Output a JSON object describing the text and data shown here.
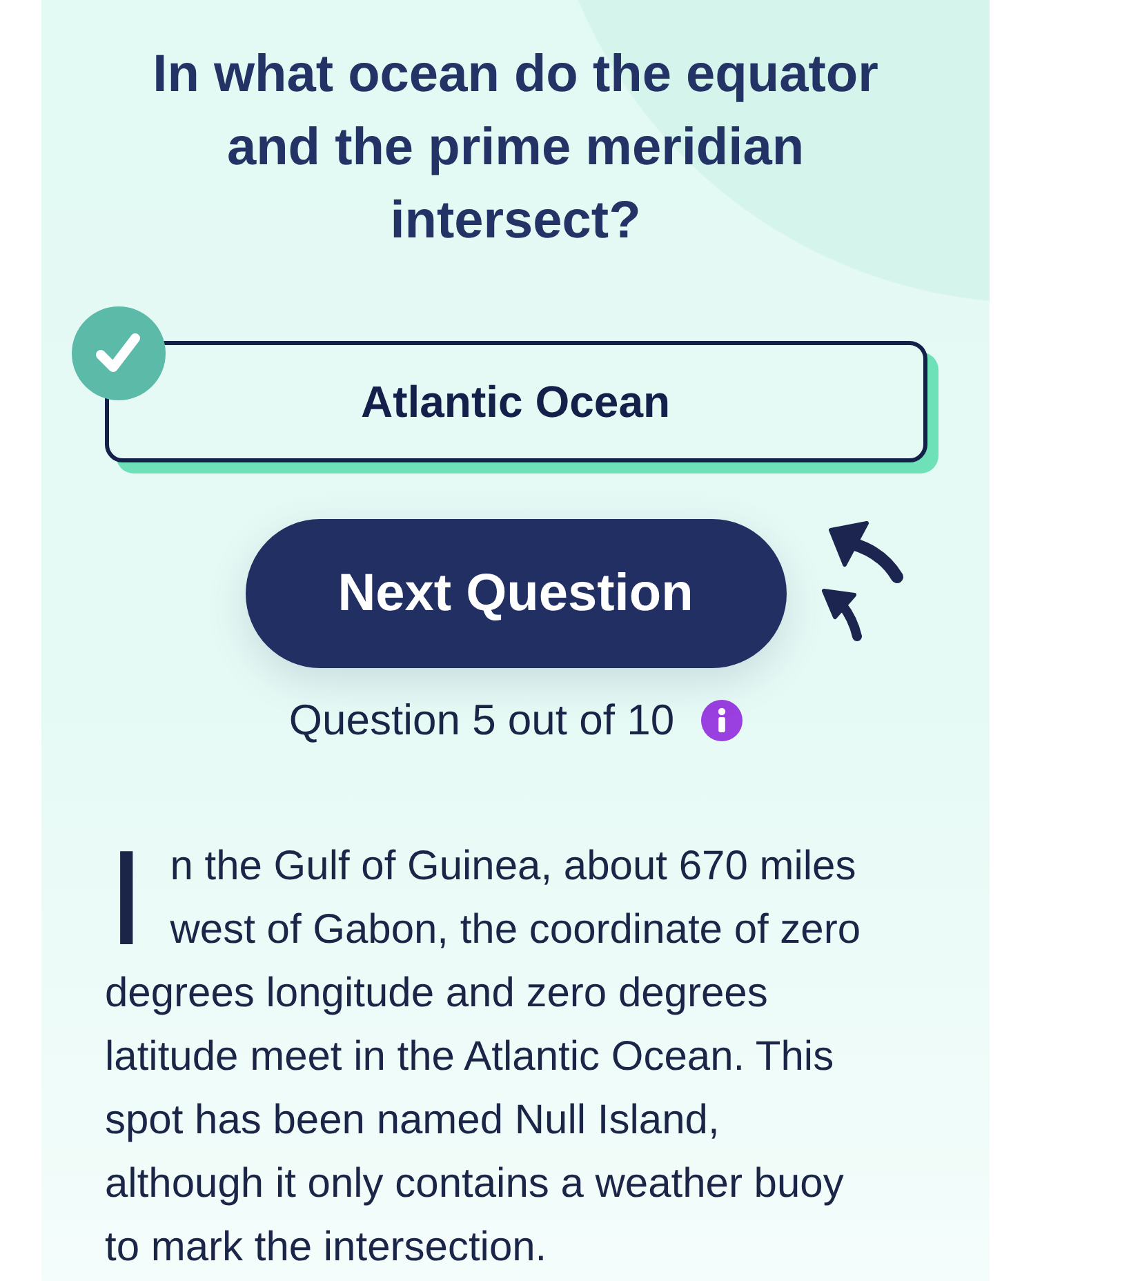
{
  "question": {
    "text": "In what ocean do the equator and the prime meridian intersect?"
  },
  "answers": [
    {
      "label": "Atlantic Ocean",
      "correct": true
    }
  ],
  "next_button": {
    "label": "Next Question"
  },
  "progress": {
    "text": "Question 5 out of 10"
  },
  "explanation": {
    "text": "In the Gulf of Guinea, about 670 miles west of Gabon, the coordinate of zero degrees longitude and zero degrees latitude meet in the Atlantic Ocean. This spot has been named Null Island, although it only contains a weather buoy to mark the intersection."
  }
}
